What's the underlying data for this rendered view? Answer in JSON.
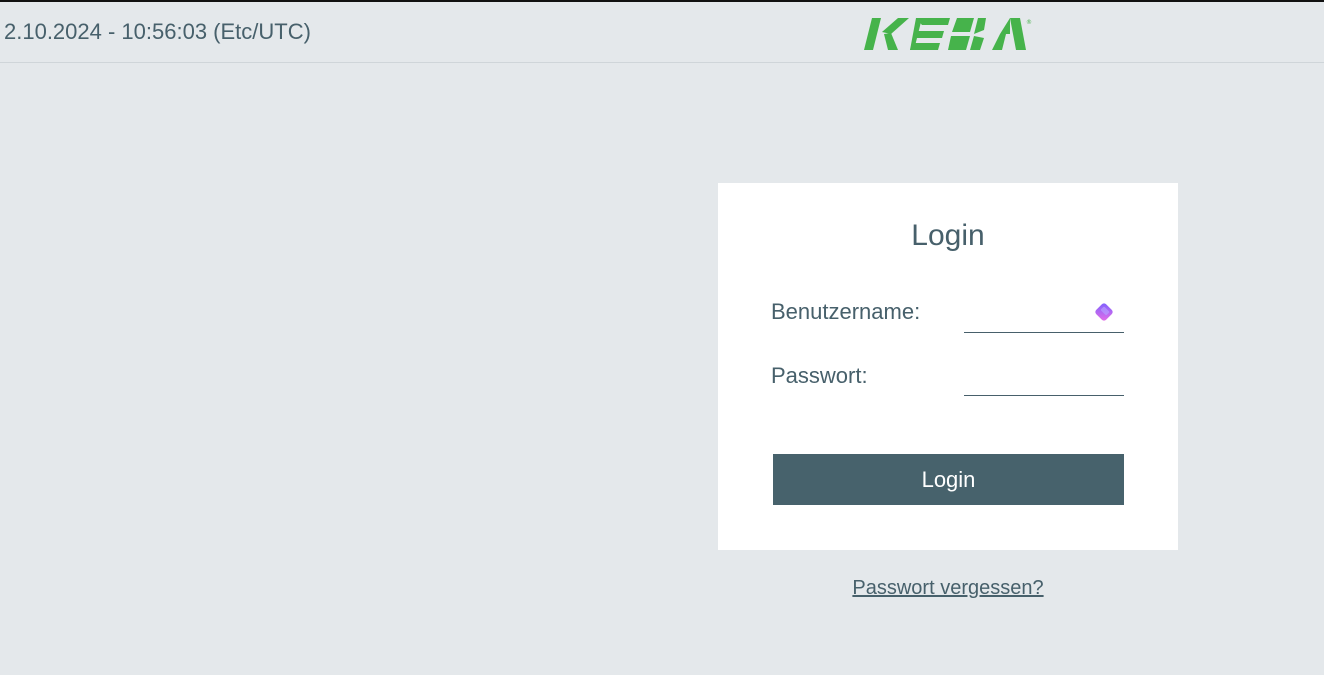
{
  "header": {
    "datetime": "2.10.2024 - 10:56:03 (Etc/UTC)",
    "logo_text": "KEBA",
    "logo_color": "#46b34b"
  },
  "login": {
    "title": "Login",
    "username_label": "Benutzername:",
    "username_value": "",
    "password_label": "Passwort:",
    "password_value": "",
    "submit_label": "Login",
    "forgot_link": "Passwort vergessen?",
    "extension_icon": "password-manager-icon"
  },
  "colors": {
    "background": "#e4e8eb",
    "text": "#47606b",
    "button": "#47626c",
    "card": "#ffffff"
  }
}
